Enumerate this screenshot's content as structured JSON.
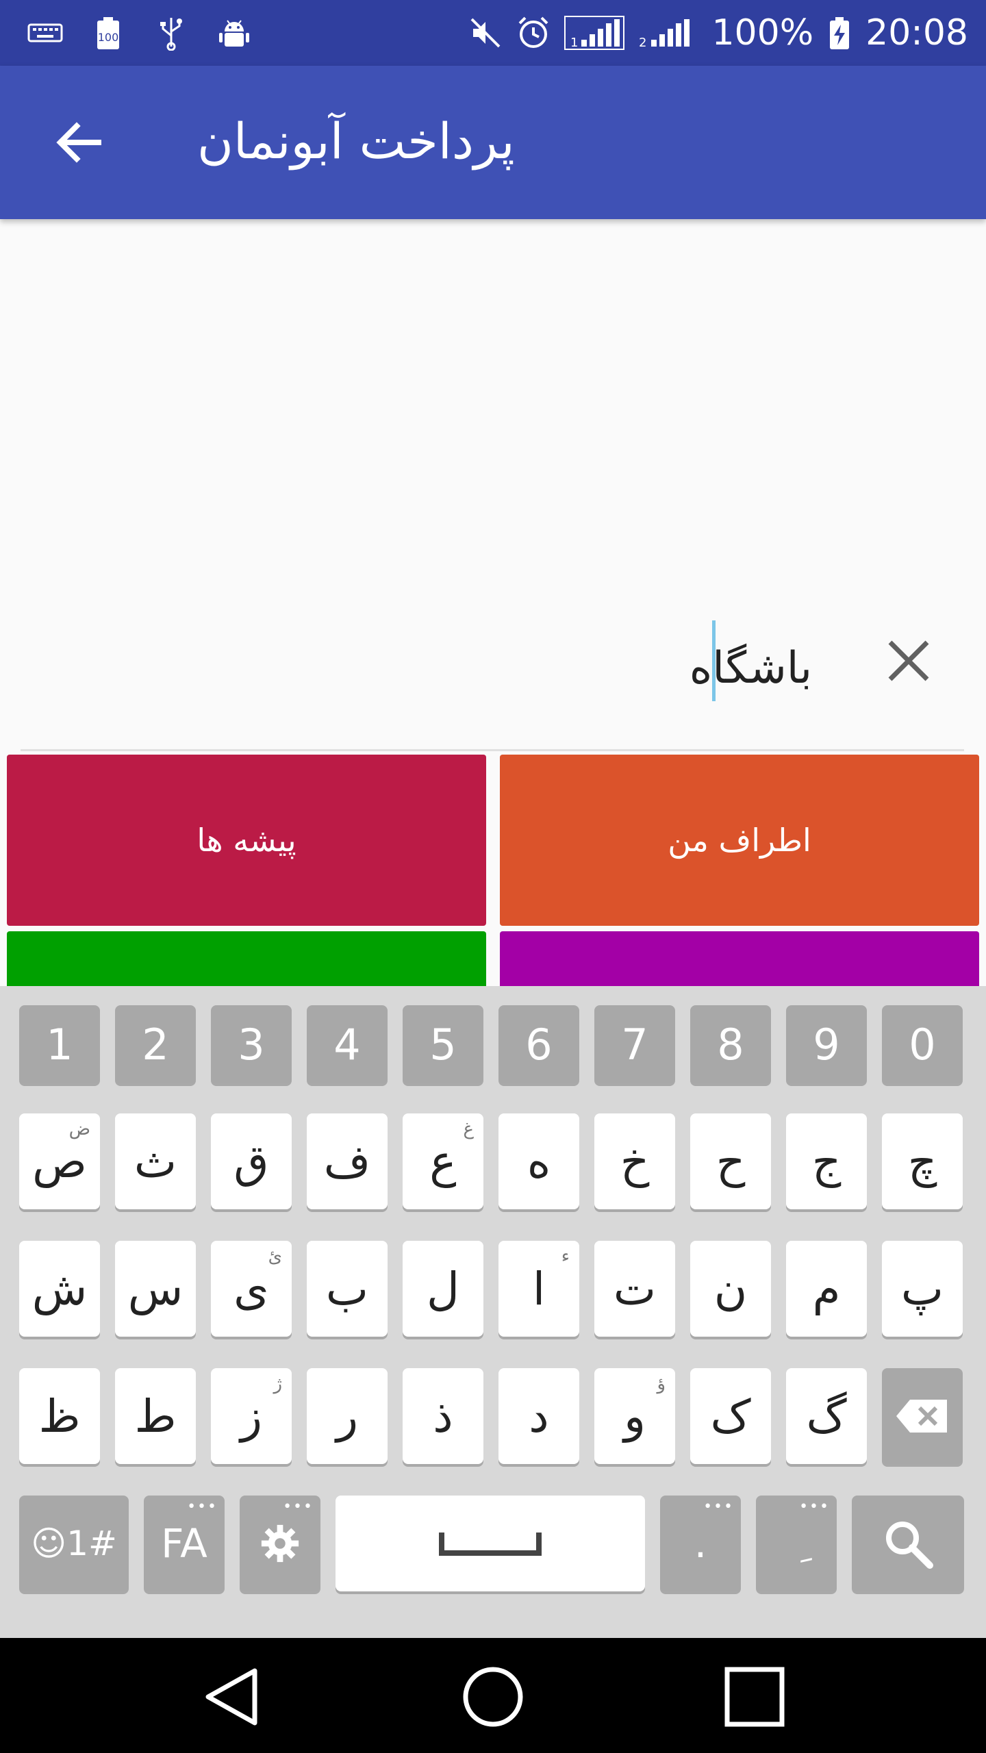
{
  "status_bar": {
    "battery_percent": "100%",
    "time": "20:08",
    "sim1_label": "1",
    "sim2_label": "2",
    "left_icons": [
      "keyboard-icon",
      "battery-100-icon",
      "usb-icon",
      "android-debug-icon"
    ],
    "right_icons": [
      "mute-icon",
      "alarm-icon",
      "signal-sim1-icon",
      "signal-sim2-icon",
      "battery-charging-icon"
    ]
  },
  "app_bar": {
    "title": "پرداخت آبونمان",
    "back_icon": "arrow-back-icon",
    "color": "#3f51b5"
  },
  "search": {
    "value": "باشگاه",
    "clear_icon": "close-icon"
  },
  "categories": [
    {
      "label": "اطراف من",
      "color": "#db532b"
    },
    {
      "label": "پیشه ها",
      "color": "#bb1b46"
    },
    {
      "label": "",
      "color": "#a300a6"
    },
    {
      "label": "",
      "color": "#00a000"
    }
  ],
  "keyboard": {
    "numbers": [
      "1",
      "2",
      "3",
      "4",
      "5",
      "6",
      "7",
      "8",
      "9",
      "0"
    ],
    "row1": [
      {
        "k": "ص",
        "s": "ض"
      },
      {
        "k": "ث",
        "s": ""
      },
      {
        "k": "ق",
        "s": ""
      },
      {
        "k": "ف",
        "s": ""
      },
      {
        "k": "ع",
        "s": "غ"
      },
      {
        "k": "ه",
        "s": ""
      },
      {
        "k": "خ",
        "s": ""
      },
      {
        "k": "ح",
        "s": ""
      },
      {
        "k": "ج",
        "s": ""
      },
      {
        "k": "چ",
        "s": ""
      }
    ],
    "row2": [
      {
        "k": "ش",
        "s": ""
      },
      {
        "k": "س",
        "s": ""
      },
      {
        "k": "ی",
        "s": "ئ"
      },
      {
        "k": "ب",
        "s": ""
      },
      {
        "k": "ل",
        "s": ""
      },
      {
        "k": "ا",
        "s": "ء"
      },
      {
        "k": "ت",
        "s": ""
      },
      {
        "k": "ن",
        "s": ""
      },
      {
        "k": "م",
        "s": ""
      },
      {
        "k": "پ",
        "s": ""
      }
    ],
    "row3": [
      {
        "k": "ظ",
        "s": ""
      },
      {
        "k": "ط",
        "s": ""
      },
      {
        "k": "ز",
        "s": "ژ"
      },
      {
        "k": "ر",
        "s": ""
      },
      {
        "k": "ذ",
        "s": ""
      },
      {
        "k": "د",
        "s": ""
      },
      {
        "k": "و",
        "s": "ؤ"
      },
      {
        "k": "ک",
        "s": ""
      },
      {
        "k": "گ",
        "s": ""
      }
    ],
    "backspace_icon": "backspace-icon",
    "symbols_label": "☺1#",
    "lang_label": "FA",
    "settings_icon": "gear-icon",
    "space_icon": "space-bar-icon",
    "period_label": ".",
    "kasra_label": "ِ",
    "search_icon": "search-icon"
  },
  "nav_bar": {
    "back_icon": "nav-back-triangle-icon",
    "home_icon": "nav-home-circle-icon",
    "recents_icon": "nav-recents-square-icon"
  }
}
